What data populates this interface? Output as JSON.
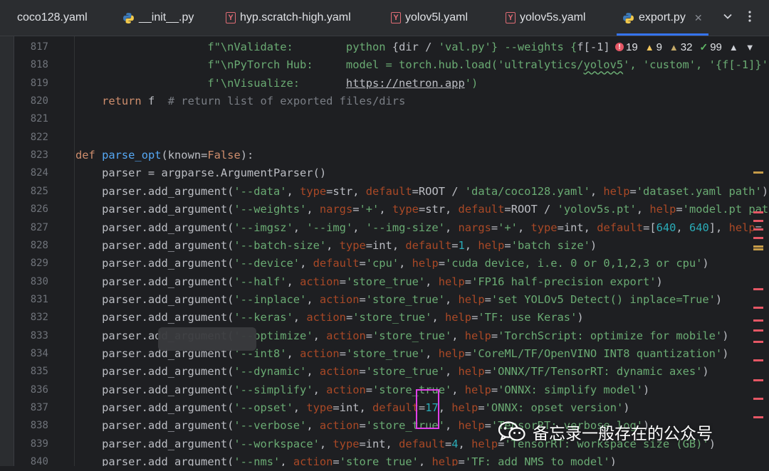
{
  "tabs": [
    {
      "label": "coco128.yaml",
      "icon": "yaml-file-icon",
      "active": false
    },
    {
      "label": "__init__.py",
      "icon": "python-file-icon",
      "active": false
    },
    {
      "label": "hyp.scratch-high.yaml",
      "icon": "yaml-file-icon",
      "active": false
    },
    {
      "label": "yolov5l.yaml",
      "icon": "yaml-file-icon",
      "active": false
    },
    {
      "label": "yolov5s.yaml",
      "icon": "yaml-file-icon",
      "active": false
    },
    {
      "label": "export.py",
      "icon": "python-file-icon",
      "active": true
    }
  ],
  "inspections": {
    "errors": "19",
    "warnings": "9",
    "weak_warnings": "32",
    "typos": "99"
  },
  "line_numbers": [
    "817",
    "818",
    "819",
    "820",
    "821",
    "822",
    "823",
    "824",
    "825",
    "826",
    "827",
    "828",
    "829",
    "830",
    "831",
    "832",
    "833",
    "834",
    "835",
    "836",
    "837",
    "838",
    "839",
    "840"
  ],
  "code_lines": [
    [
      {
        "t": "                    "
      },
      {
        "t": "f\"\\nValidate:        ",
        "c": "s"
      },
      {
        "t": "python ",
        "c": "s"
      },
      {
        "t": "{",
        "c": "d"
      },
      {
        "t": "dir / ",
        "c": "d"
      },
      {
        "t": "'val.py'",
        "c": "s"
      },
      {
        "t": "} --weights {",
        "c": "s"
      },
      {
        "t": "f[-1]",
        "c": "d"
      }
    ],
    [
      {
        "t": "                    "
      },
      {
        "t": "f\"\\nPyTorch Hub:     ",
        "c": "s"
      },
      {
        "t": "model = torch.hub.load('ultralytics/",
        "c": "s"
      },
      {
        "t": "yolov5",
        "c": "s wavy"
      },
      {
        "t": "', 'custom', '{f[-1]}'",
        "c": "s"
      }
    ],
    [
      {
        "t": "                    "
      },
      {
        "t": "f'\\nVisualize:       ",
        "c": "s"
      },
      {
        "t": "https://netron.app",
        "c": "s u"
      },
      {
        "t": "')",
        "c": "s"
      }
    ],
    [
      {
        "t": "    "
      },
      {
        "t": "return",
        "c": "k"
      },
      {
        "t": " f  ",
        "c": "d"
      },
      {
        "t": "# return list of exported files/dirs",
        "c": "c"
      }
    ],
    [
      {
        "t": ""
      }
    ],
    [
      {
        "t": ""
      }
    ],
    [
      {
        "t": "def",
        "c": "k"
      },
      {
        "t": " "
      },
      {
        "t": "parse_opt",
        "c": "f"
      },
      {
        "t": "(known=",
        "c": "d"
      },
      {
        "t": "False",
        "c": "k"
      },
      {
        "t": "):",
        "c": "d"
      }
    ],
    [
      {
        "t": "    parser = argparse.ArgumentParser()",
        "c": "d"
      }
    ],
    [
      {
        "t": "    parser.add_argument(",
        "c": "d"
      },
      {
        "t": "'--data'",
        "c": "s"
      },
      {
        "t": ", ",
        "c": "d"
      },
      {
        "t": "type",
        "c": "p"
      },
      {
        "t": "=str, ",
        "c": "d"
      },
      {
        "t": "default",
        "c": "p"
      },
      {
        "t": "=ROOT / ",
        "c": "d"
      },
      {
        "t": "'data/coco128.yaml'",
        "c": "s"
      },
      {
        "t": ", ",
        "c": "d"
      },
      {
        "t": "help",
        "c": "p"
      },
      {
        "t": "=",
        "c": "d"
      },
      {
        "t": "'dataset.yaml path'",
        "c": "s"
      },
      {
        "t": ")",
        "c": "d"
      }
    ],
    [
      {
        "t": "    parser.add_argument(",
        "c": "d"
      },
      {
        "t": "'--weights'",
        "c": "s"
      },
      {
        "t": ", ",
        "c": "d"
      },
      {
        "t": "nargs",
        "c": "p"
      },
      {
        "t": "=",
        "c": "d"
      },
      {
        "t": "'+'",
        "c": "s"
      },
      {
        "t": ", ",
        "c": "d"
      },
      {
        "t": "type",
        "c": "p"
      },
      {
        "t": "=str, ",
        "c": "d"
      },
      {
        "t": "default",
        "c": "p"
      },
      {
        "t": "=ROOT / ",
        "c": "d"
      },
      {
        "t": "'yolov5s.pt'",
        "c": "s"
      },
      {
        "t": ", ",
        "c": "d"
      },
      {
        "t": "help",
        "c": "p"
      },
      {
        "t": "=",
        "c": "d"
      },
      {
        "t": "'model.pt path(s)'",
        "c": "s"
      }
    ],
    [
      {
        "t": "    parser.add_argument(",
        "c": "d"
      },
      {
        "t": "'--imgsz'",
        "c": "s"
      },
      {
        "t": ", ",
        "c": "d"
      },
      {
        "t": "'--img'",
        "c": "s"
      },
      {
        "t": ", ",
        "c": "d"
      },
      {
        "t": "'--img-size'",
        "c": "s"
      },
      {
        "t": ", ",
        "c": "d"
      },
      {
        "t": "nargs",
        "c": "p"
      },
      {
        "t": "=",
        "c": "d"
      },
      {
        "t": "'+'",
        "c": "s"
      },
      {
        "t": ", ",
        "c": "d"
      },
      {
        "t": "type",
        "c": "p"
      },
      {
        "t": "=int, ",
        "c": "d"
      },
      {
        "t": "default",
        "c": "p"
      },
      {
        "t": "=[",
        "c": "d"
      },
      {
        "t": "640",
        "c": "n"
      },
      {
        "t": ", ",
        "c": "d"
      },
      {
        "t": "640",
        "c": "n"
      },
      {
        "t": "], ",
        "c": "d"
      },
      {
        "t": "help",
        "c": "p"
      },
      {
        "t": "=",
        "c": "d"
      }
    ],
    [
      {
        "t": "    parser.add_argument(",
        "c": "d"
      },
      {
        "t": "'--batch-size'",
        "c": "s"
      },
      {
        "t": ", ",
        "c": "d"
      },
      {
        "t": "type",
        "c": "p"
      },
      {
        "t": "=int, ",
        "c": "d"
      },
      {
        "t": "default",
        "c": "p"
      },
      {
        "t": "=",
        "c": "d"
      },
      {
        "t": "1",
        "c": "n"
      },
      {
        "t": ", ",
        "c": "d"
      },
      {
        "t": "help",
        "c": "p"
      },
      {
        "t": "=",
        "c": "d"
      },
      {
        "t": "'batch size'",
        "c": "s"
      },
      {
        "t": ")",
        "c": "d"
      }
    ],
    [
      {
        "t": "    parser.add_argument(",
        "c": "d"
      },
      {
        "t": "'--device'",
        "c": "s"
      },
      {
        "t": ", ",
        "c": "d"
      },
      {
        "t": "default",
        "c": "p"
      },
      {
        "t": "=",
        "c": "d"
      },
      {
        "t": "'cpu'",
        "c": "s"
      },
      {
        "t": ", ",
        "c": "d"
      },
      {
        "t": "help",
        "c": "p"
      },
      {
        "t": "=",
        "c": "d"
      },
      {
        "t": "'cuda device, i.e. 0 or 0,1,2,3 or cpu'",
        "c": "s"
      },
      {
        "t": ")",
        "c": "d"
      }
    ],
    [
      {
        "t": "    parser.add_argument(",
        "c": "d"
      },
      {
        "t": "'--half'",
        "c": "s"
      },
      {
        "t": ", ",
        "c": "d"
      },
      {
        "t": "action",
        "c": "p"
      },
      {
        "t": "=",
        "c": "d"
      },
      {
        "t": "'store_true'",
        "c": "s"
      },
      {
        "t": ", ",
        "c": "d"
      },
      {
        "t": "help",
        "c": "p"
      },
      {
        "t": "=",
        "c": "d"
      },
      {
        "t": "'FP16 half-precision export'",
        "c": "s"
      },
      {
        "t": ")",
        "c": "d"
      }
    ],
    [
      {
        "t": "    parser.add_argument(",
        "c": "d"
      },
      {
        "t": "'--inplace'",
        "c": "s"
      },
      {
        "t": ", ",
        "c": "d"
      },
      {
        "t": "action",
        "c": "p"
      },
      {
        "t": "=",
        "c": "d"
      },
      {
        "t": "'store_true'",
        "c": "s"
      },
      {
        "t": ", ",
        "c": "d"
      },
      {
        "t": "help",
        "c": "p"
      },
      {
        "t": "=",
        "c": "d"
      },
      {
        "t": "'set YOLOv5 Detect() inplace=True'",
        "c": "s"
      },
      {
        "t": ")",
        "c": "d"
      }
    ],
    [
      {
        "t": "    parser.add_argument(",
        "c": "d"
      },
      {
        "t": "'--keras'",
        "c": "s"
      },
      {
        "t": ", ",
        "c": "d"
      },
      {
        "t": "action",
        "c": "p"
      },
      {
        "t": "=",
        "c": "d"
      },
      {
        "t": "'store_true'",
        "c": "s"
      },
      {
        "t": ", ",
        "c": "d"
      },
      {
        "t": "help",
        "c": "p"
      },
      {
        "t": "=",
        "c": "d"
      },
      {
        "t": "'TF: use Keras'",
        "c": "s"
      },
      {
        "t": ")",
        "c": "d"
      }
    ],
    [
      {
        "t": "    parser.add_argument(",
        "c": "d"
      },
      {
        "t": "'--optimize'",
        "c": "s"
      },
      {
        "t": ", ",
        "c": "d"
      },
      {
        "t": "action",
        "c": "p"
      },
      {
        "t": "=",
        "c": "d"
      },
      {
        "t": "'store_true'",
        "c": "s"
      },
      {
        "t": ", ",
        "c": "d"
      },
      {
        "t": "help",
        "c": "p"
      },
      {
        "t": "=",
        "c": "d"
      },
      {
        "t": "'TorchScript: optimize for mobile'",
        "c": "s"
      },
      {
        "t": ")",
        "c": "d"
      }
    ],
    [
      {
        "t": "    parser.add_argument(",
        "c": "d"
      },
      {
        "t": "'--int8'",
        "c": "s"
      },
      {
        "t": ", ",
        "c": "d"
      },
      {
        "t": "action",
        "c": "p"
      },
      {
        "t": "=",
        "c": "d"
      },
      {
        "t": "'store_true'",
        "c": "s"
      },
      {
        "t": ", ",
        "c": "d"
      },
      {
        "t": "help",
        "c": "p"
      },
      {
        "t": "=",
        "c": "d"
      },
      {
        "t": "'CoreML/TF/OpenVINO INT8 quantization'",
        "c": "s"
      },
      {
        "t": ")",
        "c": "d"
      }
    ],
    [
      {
        "t": "    parser.add_argument(",
        "c": "d"
      },
      {
        "t": "'--dynamic'",
        "c": "s"
      },
      {
        "t": ", ",
        "c": "d"
      },
      {
        "t": "action",
        "c": "p"
      },
      {
        "t": "=",
        "c": "d"
      },
      {
        "t": "'store_true'",
        "c": "s"
      },
      {
        "t": ", ",
        "c": "d"
      },
      {
        "t": "help",
        "c": "p"
      },
      {
        "t": "=",
        "c": "d"
      },
      {
        "t": "'ONNX/TF/TensorRT: dynamic axes'",
        "c": "s"
      },
      {
        "t": ")",
        "c": "d"
      }
    ],
    [
      {
        "t": "    parser.add_argument(",
        "c": "d"
      },
      {
        "t": "'--simplify'",
        "c": "s"
      },
      {
        "t": ", ",
        "c": "d"
      },
      {
        "t": "action",
        "c": "p"
      },
      {
        "t": "=",
        "c": "d"
      },
      {
        "t": "'store_true'",
        "c": "s"
      },
      {
        "t": ", ",
        "c": "d"
      },
      {
        "t": "help",
        "c": "p"
      },
      {
        "t": "=",
        "c": "d"
      },
      {
        "t": "'ONNX: simplify model'",
        "c": "s"
      },
      {
        "t": ")",
        "c": "d"
      }
    ],
    [
      {
        "t": "    parser.add_argument(",
        "c": "d"
      },
      {
        "t": "'--opset'",
        "c": "s"
      },
      {
        "t": ", ",
        "c": "d"
      },
      {
        "t": "type",
        "c": "p"
      },
      {
        "t": "=int, ",
        "c": "d"
      },
      {
        "t": "default",
        "c": "p"
      },
      {
        "t": "=",
        "c": "d"
      },
      {
        "t": "17",
        "c": "n"
      },
      {
        "t": ", ",
        "c": "d"
      },
      {
        "t": "help",
        "c": "p"
      },
      {
        "t": "=",
        "c": "d"
      },
      {
        "t": "'ONNX: opset version'",
        "c": "s"
      },
      {
        "t": ")",
        "c": "d"
      }
    ],
    [
      {
        "t": "    parser.add_argument(",
        "c": "d"
      },
      {
        "t": "'--verbose'",
        "c": "s"
      },
      {
        "t": ", ",
        "c": "d"
      },
      {
        "t": "action",
        "c": "p"
      },
      {
        "t": "=",
        "c": "d"
      },
      {
        "t": "'store_true'",
        "c": "s"
      },
      {
        "t": ", ",
        "c": "d"
      },
      {
        "t": "help",
        "c": "p"
      },
      {
        "t": "=",
        "c": "d"
      },
      {
        "t": "'TensorRT: verbose log'",
        "c": "s"
      },
      {
        "t": ")",
        "c": "d"
      }
    ],
    [
      {
        "t": "    parser.add_argument(",
        "c": "d"
      },
      {
        "t": "'--workspace'",
        "c": "s"
      },
      {
        "t": ", ",
        "c": "d"
      },
      {
        "t": "type",
        "c": "p"
      },
      {
        "t": "=int, ",
        "c": "d"
      },
      {
        "t": "default",
        "c": "p"
      },
      {
        "t": "=",
        "c": "d"
      },
      {
        "t": "4",
        "c": "n"
      },
      {
        "t": ", ",
        "c": "d"
      },
      {
        "t": "help",
        "c": "p"
      },
      {
        "t": "=",
        "c": "d"
      },
      {
        "t": "'TensorRT: workspace size (GB)'",
        "c": "s"
      },
      {
        "t": ")",
        "c": "d"
      }
    ],
    [
      {
        "t": "    parser.add_argument(",
        "c": "d"
      },
      {
        "t": "'--nms'",
        "c": "s"
      },
      {
        "t": ", ",
        "c": "d"
      },
      {
        "t": "action",
        "c": "p"
      },
      {
        "t": "=",
        "c": "d"
      },
      {
        "t": "'store_true'",
        "c": "s"
      },
      {
        "t": ", ",
        "c": "d"
      },
      {
        "t": "help",
        "c": "p"
      },
      {
        "t": "=",
        "c": "d"
      },
      {
        "t": "'TF: add NMS to model'",
        "c": "s"
      },
      {
        "t": ")",
        "c": "d"
      }
    ]
  ],
  "watermark": {
    "text": "备忘录一般存在的公众号"
  },
  "colors": {
    "accent": "#3574f0",
    "highlight_box": "#e040e8",
    "error": "#e55765",
    "warning": "#f2c55c",
    "ok": "#5fb865"
  }
}
